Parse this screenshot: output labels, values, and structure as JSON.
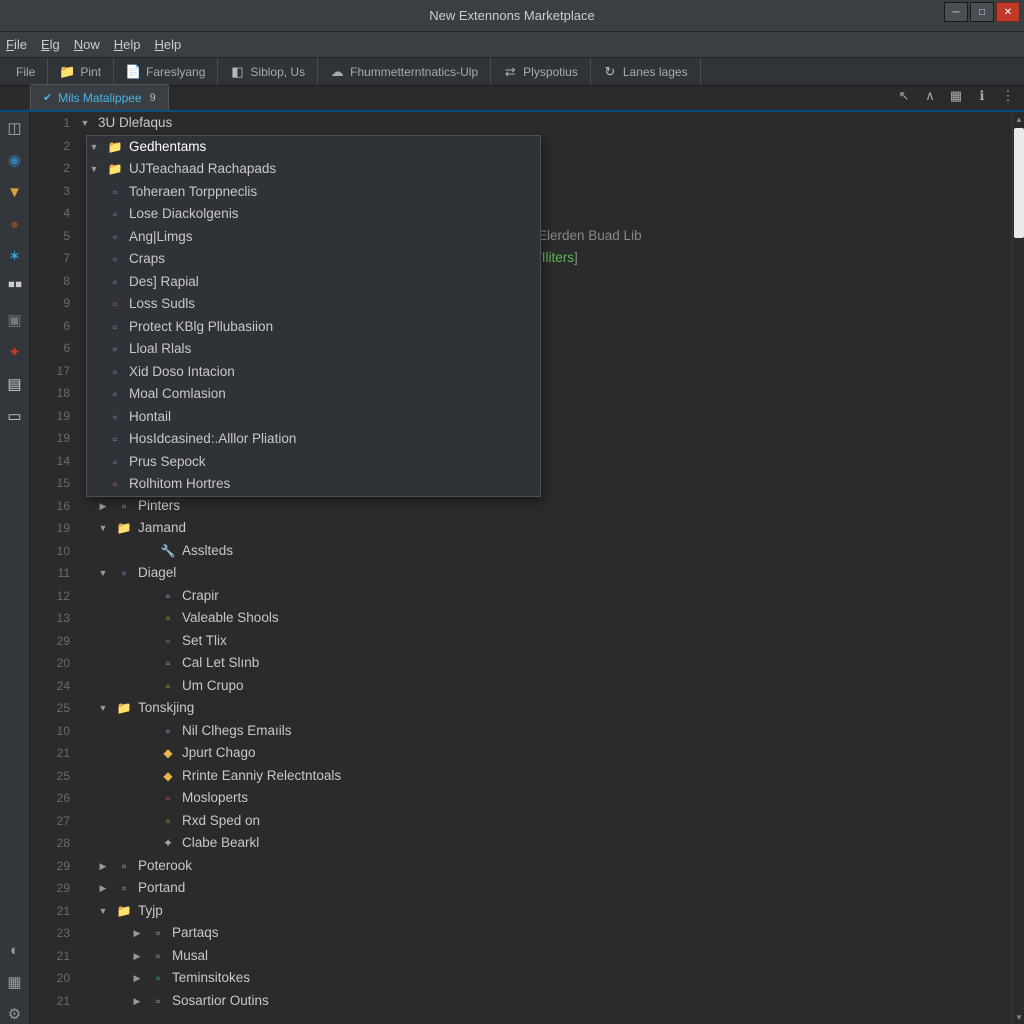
{
  "window": {
    "title": "New Extennons Marketplace"
  },
  "menu": {
    "items": [
      "File",
      "Elg",
      "Now",
      "Help",
      "Help"
    ]
  },
  "toolbar_groups": [
    {
      "icon": "",
      "label": "File"
    },
    {
      "icon": "folder",
      "label": "Pint"
    },
    {
      "icon": "page",
      "label": "Fareslyang"
    },
    {
      "icon": "badge",
      "label": "Siblop, Us"
    },
    {
      "icon": "cloud",
      "label": "Fhummetterntnatics-Ulp"
    },
    {
      "icon": "arrows",
      "label": "Plyspotius"
    },
    {
      "icon": "cycle",
      "label": "Lanes lages"
    }
  ],
  "tab": {
    "label": "Mils Matalippee",
    "badge": "9"
  },
  "gutter": [
    "1",
    "2",
    "2",
    "3",
    "4",
    "5",
    "7",
    "8",
    "9",
    "6",
    "6",
    "17",
    "18",
    "19",
    "19",
    "14",
    "15",
    "16",
    "19",
    "10",
    "11",
    "12",
    "13",
    "29",
    "20",
    "24",
    "25",
    "10",
    "21",
    "25",
    "26",
    "27",
    "28",
    "29",
    "29",
    "21",
    "23",
    "21",
    "20",
    "21"
  ],
  "root": {
    "label": "3U Dlefaqus"
  },
  "popup": [
    {
      "type": "folder-sel",
      "label": "Gedhentams",
      "indent": 2
    },
    {
      "type": "folder-sub",
      "label": "UJTeachaad Rachapads",
      "indent": 2
    },
    {
      "type": "file-blue",
      "label": "Toheraen Torppneclis",
      "indent": 3
    },
    {
      "type": "file-blue",
      "label": "Lose Diackolgenis",
      "indent": 3
    },
    {
      "type": "file-blue",
      "label": "Ang|Limgs",
      "indent": 3
    },
    {
      "type": "file-blue",
      "label": "Craps",
      "indent": 3
    },
    {
      "type": "file-blue",
      "label": "Des] Rapial",
      "indent": 3
    },
    {
      "type": "file-red",
      "label": "Loss Sudls",
      "indent": 3
    },
    {
      "type": "file-blue",
      "label": "Proteсt KBlg Pllubasiion",
      "indent": 3
    },
    {
      "type": "file-doc",
      "label": "Lloal Rlals",
      "indent": 3
    },
    {
      "type": "file-blue",
      "label": "Xid Doso Intacion",
      "indent": 3
    },
    {
      "type": "file-blue",
      "label": "Moal Comlasion",
      "indent": 3
    },
    {
      "type": "file-blue",
      "label": "Hontail",
      "indent": 3
    },
    {
      "type": "file-doc",
      "label": "HosIdcasined:.Alllor Pliation",
      "indent": 3
    },
    {
      "type": "file-blue",
      "label": "Prus Sepock",
      "indent": 3
    },
    {
      "type": "file-red",
      "label": "Rolhitom Hortres",
      "indent": 3
    }
  ],
  "hints": {
    "row5": "Elerden Buad Lib",
    "row6_prefix": "[ ",
    "row6_text": "Iliters",
    "row6_suffix": " ]"
  },
  "tree": [
    {
      "tw": "closed",
      "icon": "file-page",
      "label": "Pinters",
      "indent": 1
    },
    {
      "tw": "open",
      "icon": "folder",
      "label": "Jamand",
      "indent": 1
    },
    {
      "tw": "",
      "icon": "file-key",
      "label": "Asslteds",
      "indent": 3
    },
    {
      "tw": "open",
      "icon": "file-doc",
      "label": "Diagel",
      "indent": 1
    },
    {
      "tw": "",
      "icon": "file-page",
      "label": "Crapir",
      "indent": 3
    },
    {
      "tw": "",
      "icon": "file-folder-y",
      "label": "Valeable Shools",
      "indent": 3
    },
    {
      "tw": "",
      "icon": "file-green",
      "label": "Set Tlix",
      "indent": 3
    },
    {
      "tw": "",
      "icon": "file-page",
      "label": "Cal Let Slınb",
      "indent": 3
    },
    {
      "tw": "",
      "icon": "file-folder-y",
      "label": "Um Crupo",
      "indent": 3
    },
    {
      "tw": "open",
      "icon": "folder",
      "label": "Tonskjing",
      "indent": 1
    },
    {
      "tw": "",
      "icon": "file-page",
      "label": "Nil Clhegs Emaıils",
      "indent": 3
    },
    {
      "tw": "",
      "icon": "file-diamond",
      "label": "Jpurt Chago",
      "indent": 3
    },
    {
      "tw": "",
      "icon": "file-diamond",
      "label": "Rrinte Eanniy Relectntoals",
      "indent": 3
    },
    {
      "tw": "",
      "icon": "file-red",
      "label": "Mosloperts",
      "indent": 3
    },
    {
      "tw": "",
      "icon": "file-folder-y",
      "label": "Rxd Sped on",
      "indent": 3
    },
    {
      "tw": "",
      "icon": "file-gear",
      "label": "Clabe Bearkl",
      "indent": 3
    },
    {
      "tw": "closed",
      "icon": "file-page",
      "label": "Poterook",
      "indent": 1
    },
    {
      "tw": "closed",
      "icon": "file-page",
      "label": "Portand",
      "indent": 1
    },
    {
      "tw": "open",
      "icon": "folder",
      "label": "Tyjp",
      "indent": 1
    },
    {
      "tw": "closed",
      "icon": "file-page",
      "label": "Partaqs",
      "indent": 25
    },
    {
      "tw": "closed",
      "icon": "file-page",
      "label": "Musal",
      "indent": 25
    },
    {
      "tw": "closed",
      "icon": "file-teal",
      "label": "Teminsitokes",
      "indent": 25
    },
    {
      "tw": "closed",
      "icon": "file-page",
      "label": "Sosartior Outins",
      "indent": 25
    }
  ]
}
